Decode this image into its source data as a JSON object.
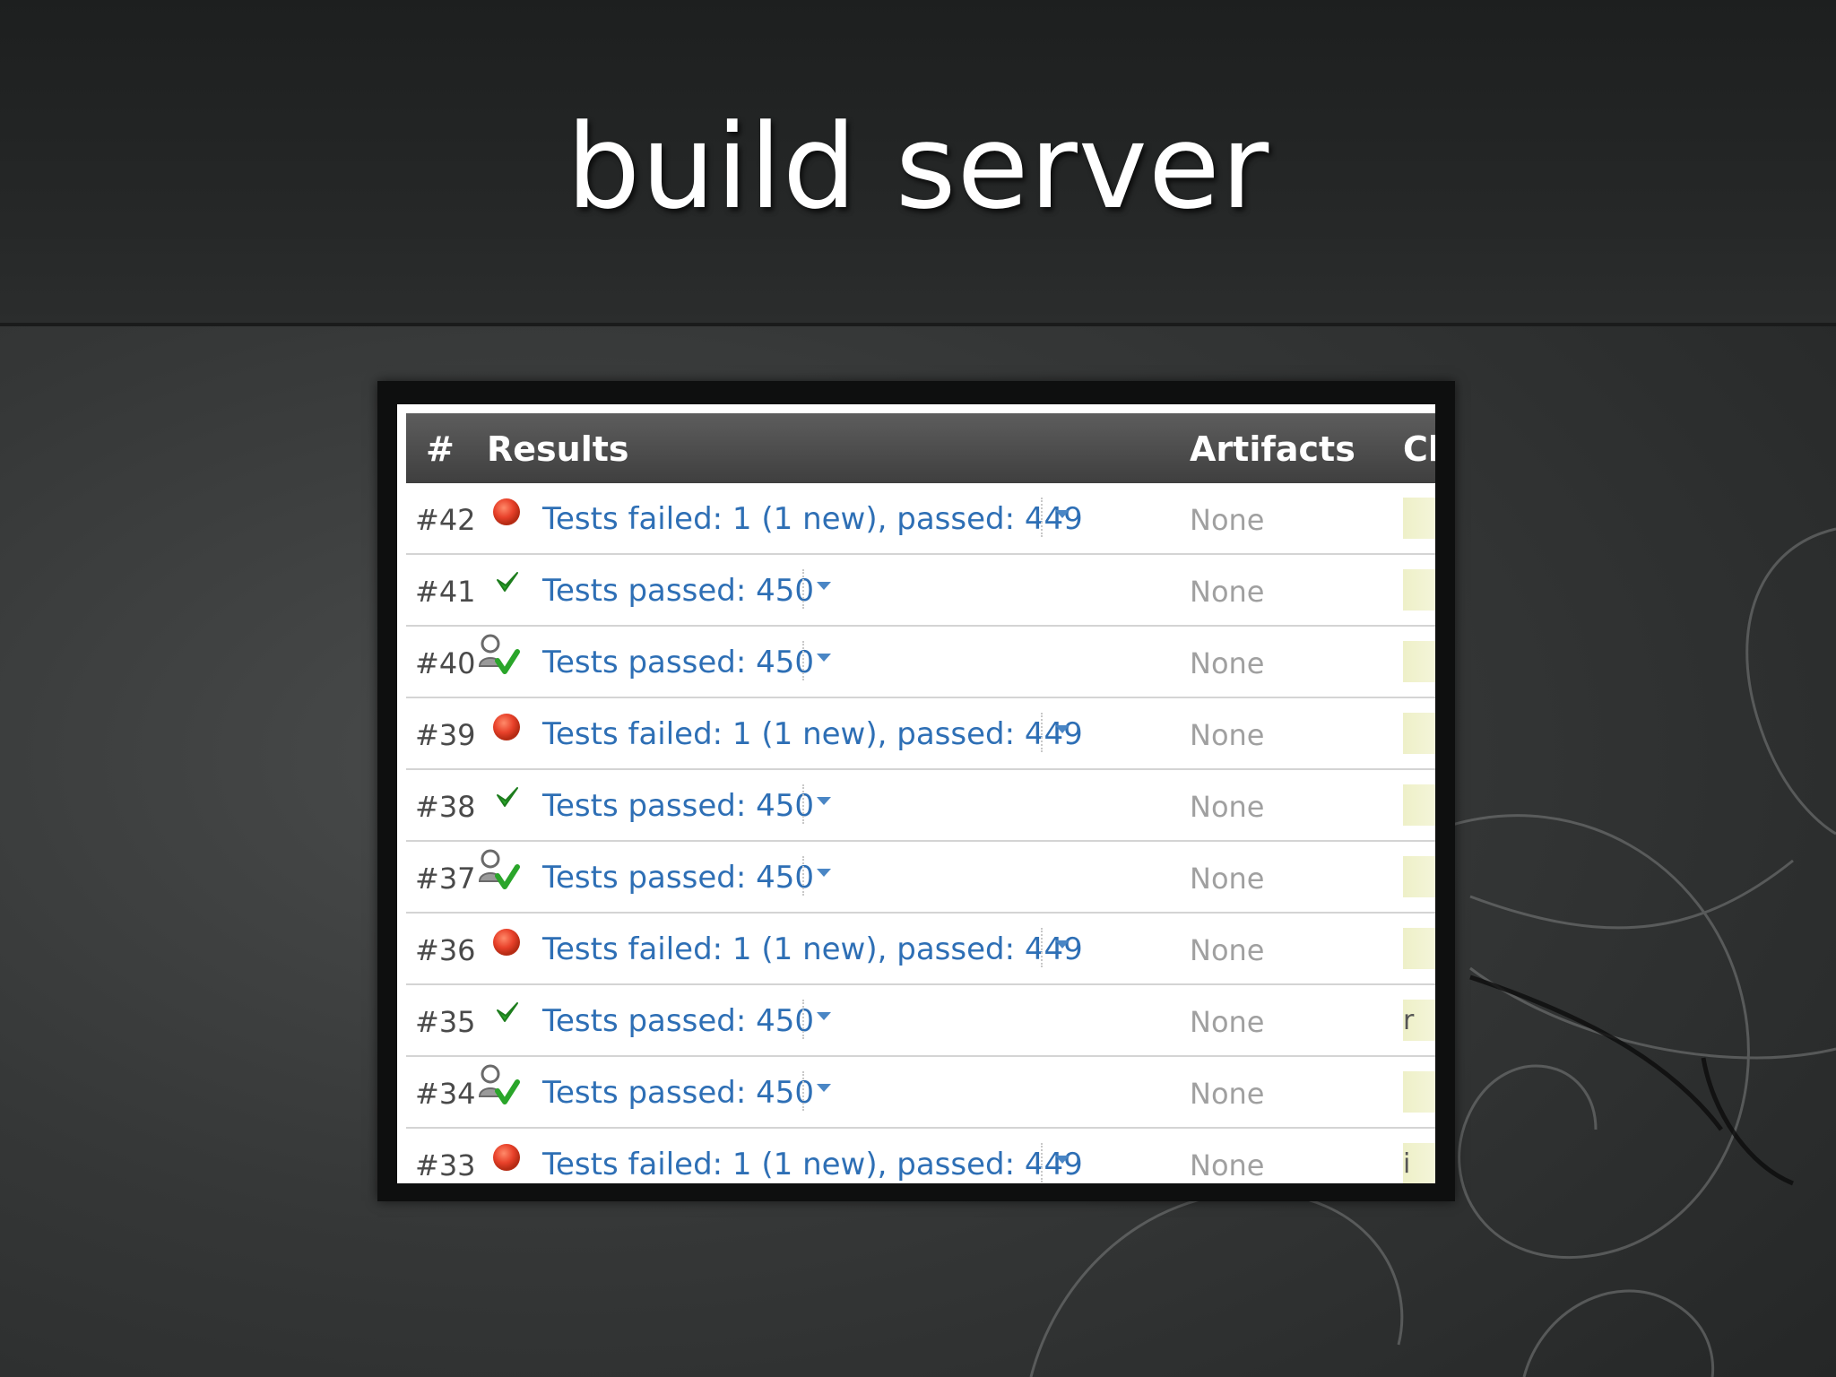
{
  "slide": {
    "title": "build server"
  },
  "table": {
    "headers": {
      "num": "#",
      "results": "Results",
      "artifacts": "Artifacts",
      "changes": "Cl"
    },
    "rows": [
      {
        "num": "#42",
        "status": "failed",
        "icon": "red-dot-icon",
        "result": "Tests failed: 1 (1 new), passed: 449",
        "artifacts": "None",
        "changes": ""
      },
      {
        "num": "#41",
        "status": "passed",
        "icon": "green-check-icon",
        "result": "Tests passed: 450",
        "artifacts": "None",
        "changes": ""
      },
      {
        "num": "#40",
        "status": "passed-personal",
        "icon": "personal-build-check-icon",
        "result": "Tests passed: 450",
        "artifacts": "None",
        "changes": ""
      },
      {
        "num": "#39",
        "status": "failed",
        "icon": "red-dot-icon",
        "result": "Tests failed: 1 (1 new), passed: 449",
        "artifacts": "None",
        "changes": ""
      },
      {
        "num": "#38",
        "status": "passed",
        "icon": "green-check-icon",
        "result": "Tests passed: 450",
        "artifacts": "None",
        "changes": ""
      },
      {
        "num": "#37",
        "status": "passed-personal",
        "icon": "personal-build-check-icon",
        "result": "Tests passed: 450",
        "artifacts": "None",
        "changes": ""
      },
      {
        "num": "#36",
        "status": "failed",
        "icon": "red-dot-icon",
        "result": "Tests failed: 1 (1 new), passed: 449",
        "artifacts": "None",
        "changes": ""
      },
      {
        "num": "#35",
        "status": "passed",
        "icon": "green-check-icon",
        "result": "Tests passed: 450",
        "artifacts": "None",
        "changes": "r"
      },
      {
        "num": "#34",
        "status": "passed-personal",
        "icon": "personal-build-check-icon",
        "result": "Tests passed: 450",
        "artifacts": "None",
        "changes": ""
      },
      {
        "num": "#33",
        "status": "failed",
        "icon": "red-dot-icon",
        "result": "Tests failed: 1 (1 new), passed: 449",
        "artifacts": "None",
        "changes": "i"
      }
    ]
  },
  "colors": {
    "link": "#2e6fb5",
    "failed": "#e8412a",
    "passed": "#2aa52a",
    "header_bg": "#4a4a4a"
  }
}
